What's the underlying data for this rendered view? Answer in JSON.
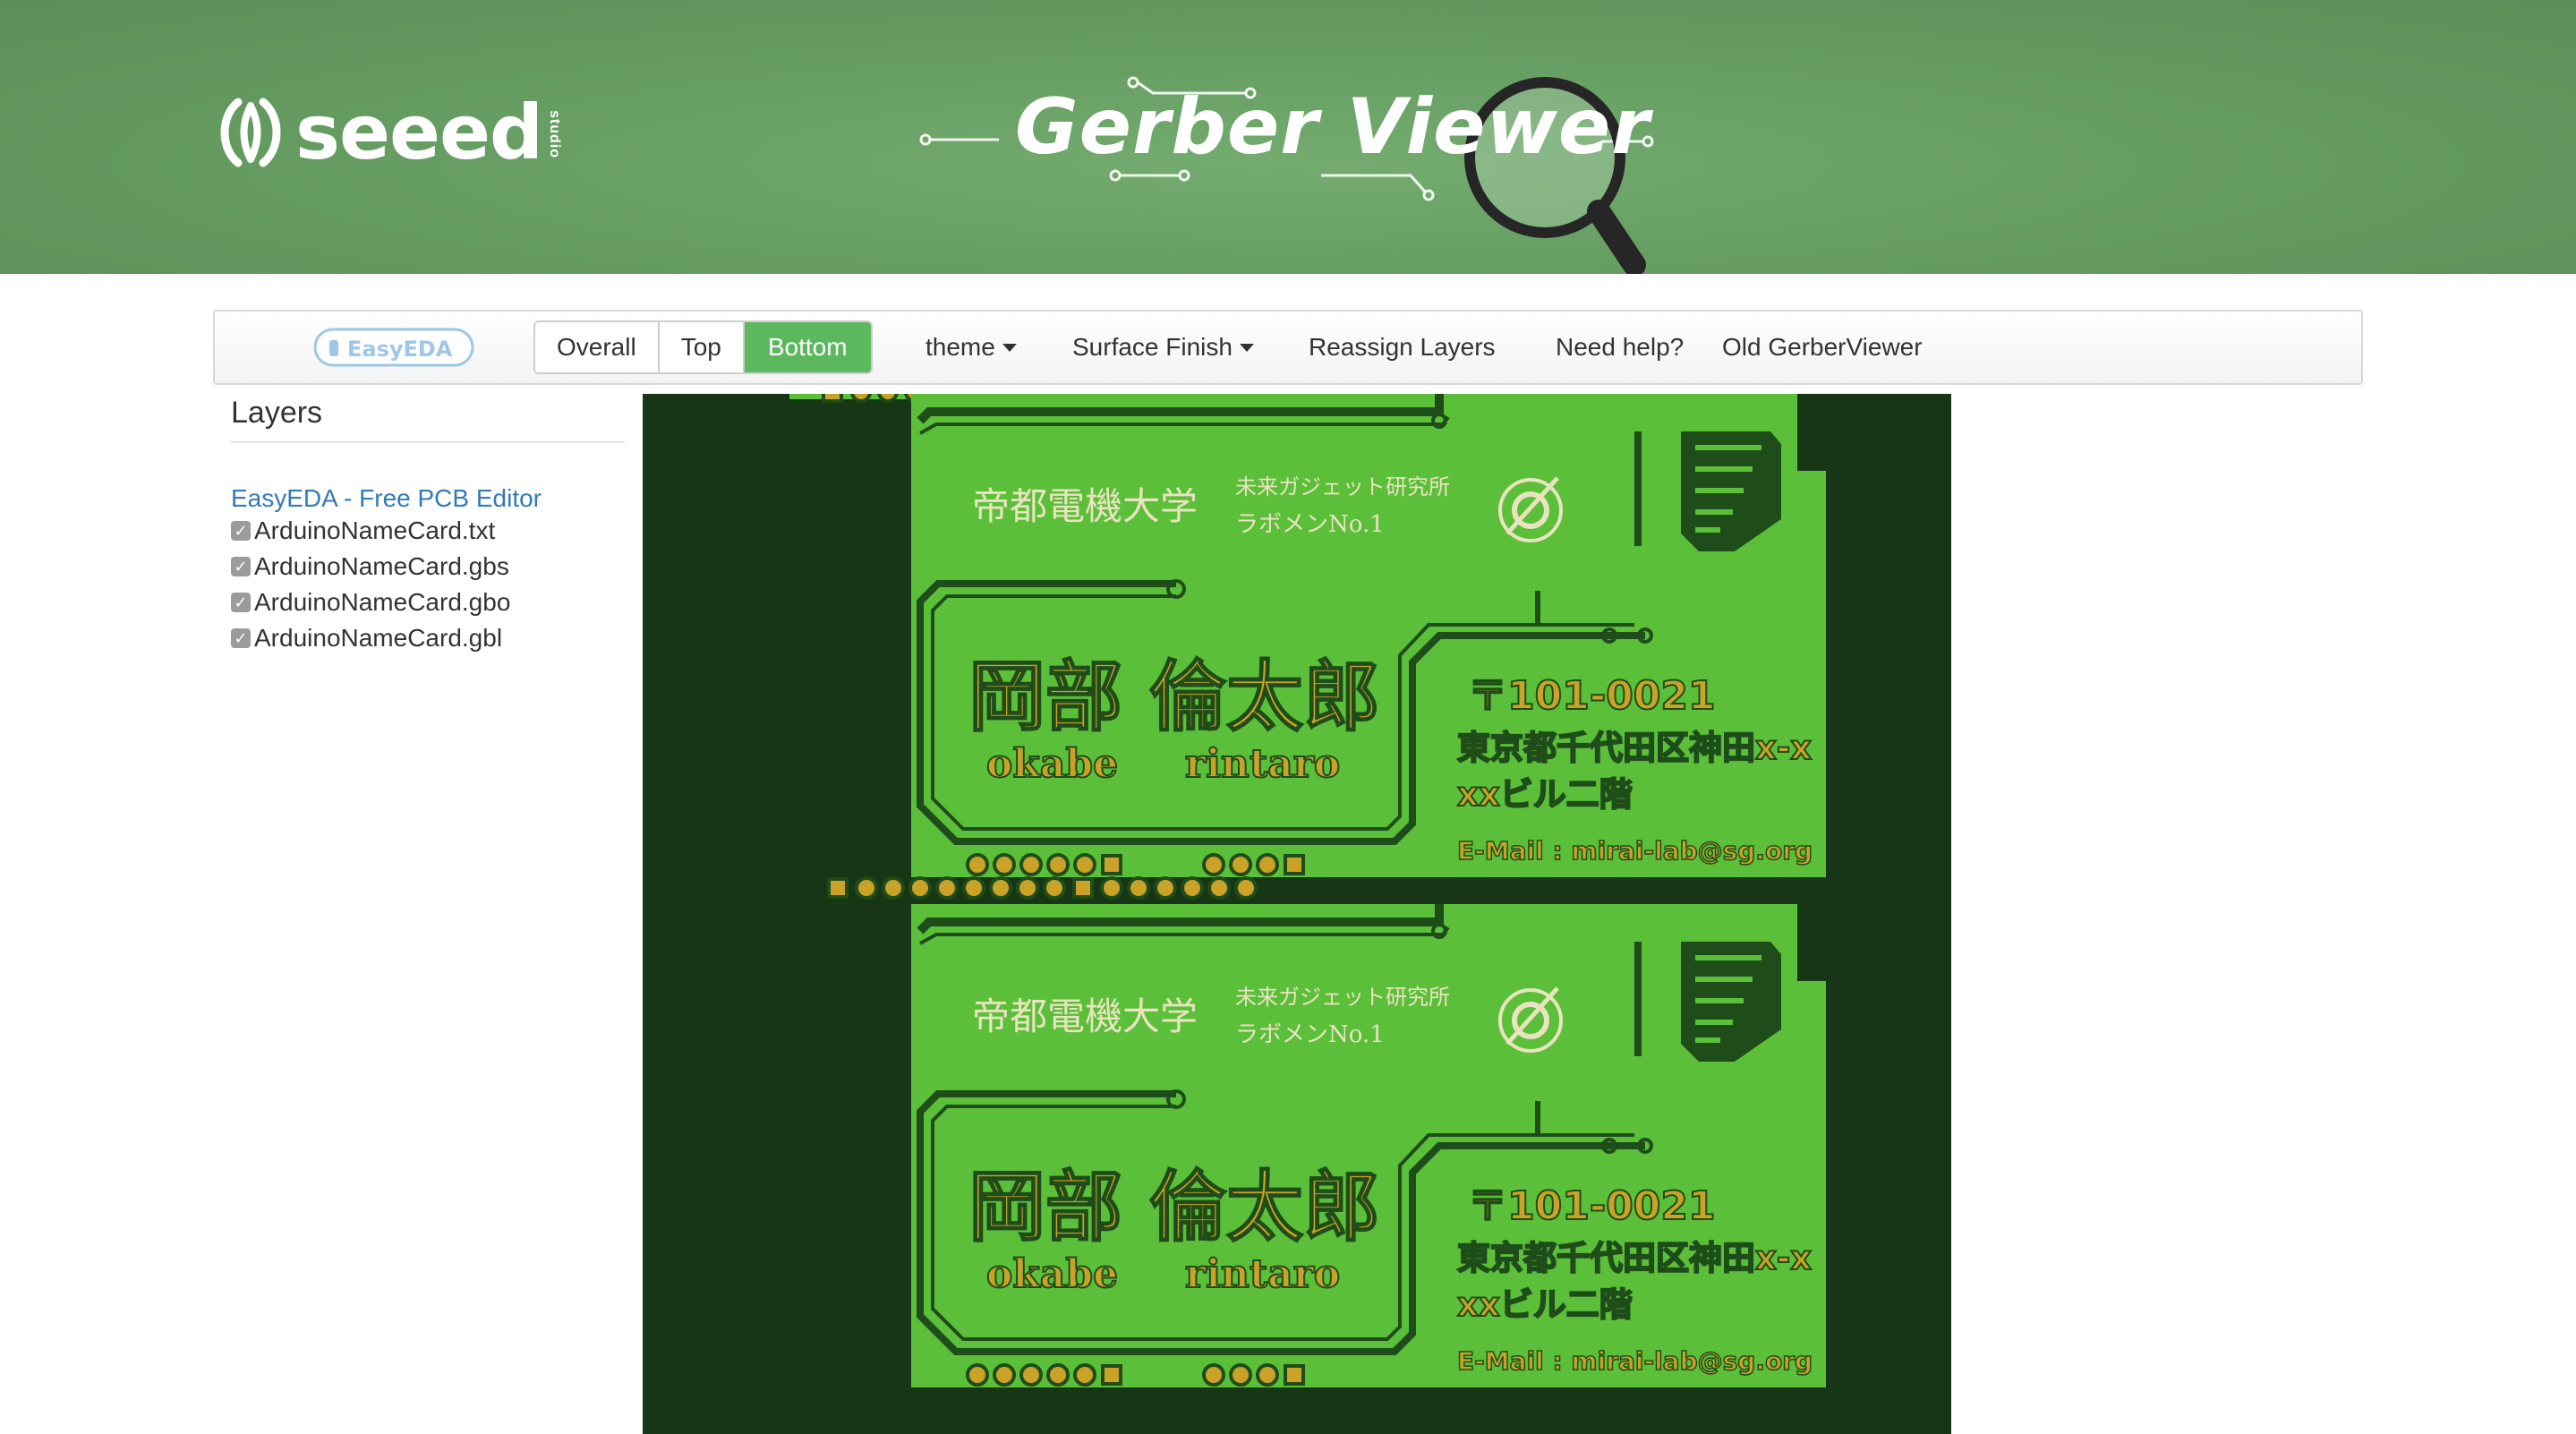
{
  "header": {
    "brand": "seeed",
    "brand_sub": "studio",
    "title": "Gerber Viewer"
  },
  "toolbar": {
    "easyeda_logo": "EasyEDA",
    "views": [
      {
        "label": "Overall",
        "active": false
      },
      {
        "label": "Top",
        "active": false
      },
      {
        "label": "Bottom",
        "active": true
      }
    ],
    "menu": {
      "theme": "theme",
      "surface_finish": "Surface Finish",
      "reassign_layers": "Reassign Layers",
      "need_help": "Need help?",
      "old_viewer": "Old GerberViewer"
    }
  },
  "sidebar": {
    "title": "Layers",
    "link": "EasyEDA - Free PCB Editor",
    "layers": [
      {
        "name": "ArduinoNameCard.txt",
        "checked": true
      },
      {
        "name": "ArduinoNameCard.gbs",
        "checked": true
      },
      {
        "name": "ArduinoNameCard.gbo",
        "checked": true
      },
      {
        "name": "ArduinoNameCard.gbl",
        "checked": true
      }
    ]
  },
  "pcb": {
    "university": "帝都電機大学",
    "lab_line1": "未来ガジェット研究所",
    "lab_line2": "ラボメンNo.1",
    "name_jp": "岡部 倫太郎",
    "name_first": "okabe",
    "name_last": "rintaro",
    "postal": "〒101-0021",
    "address1": "東京都千代田区神田x-x",
    "address2": "xxビル二階",
    "email": "E-Mail : mirai-lab@sg.org"
  },
  "colors": {
    "banner": "#6aa466",
    "board_bg": "#163616",
    "board": "#5cbf3a",
    "trace": "#1f4d1a",
    "silk": "#e9e3c0",
    "gold": "#c9a227",
    "active_button": "#5cb85c",
    "link": "#337ab7"
  }
}
